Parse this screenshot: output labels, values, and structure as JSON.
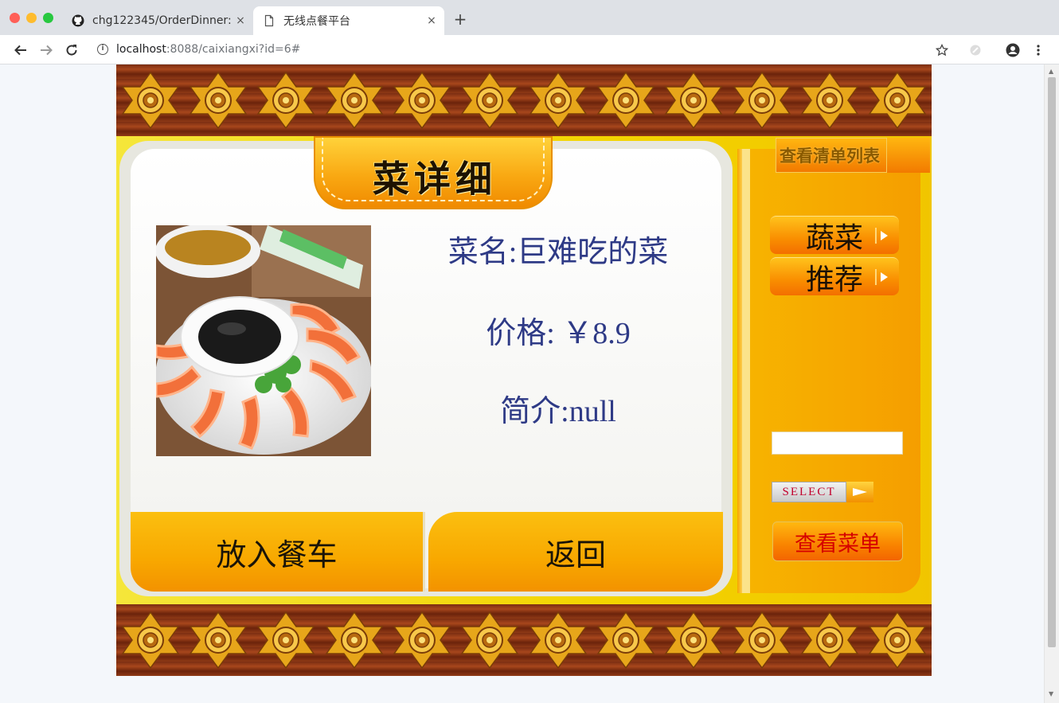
{
  "browser": {
    "tabs": [
      {
        "title": "chg122345/OrderDinner:",
        "icon": "github-icon",
        "active": false
      },
      {
        "title": "无线点餐平台",
        "icon": "document-icon",
        "active": true
      }
    ],
    "close_glyph": "×",
    "new_tab_glyph": "+",
    "url_host": "localhost",
    "url_rest": ":8088/caixiangxi?id=6#"
  },
  "page": {
    "title": "菜详细",
    "dish": {
      "name_text": "菜名:巨难吃的菜",
      "price_text": "价格: ￥8.9",
      "intro_text": "简介:null"
    },
    "buttons": {
      "add_to_cart": "放入餐车",
      "back": "返回"
    },
    "sidebar": {
      "view_list_label": "查看清单列表",
      "categories": [
        {
          "label": "蔬菜"
        },
        {
          "label": "推荐"
        }
      ],
      "search_value": "",
      "select_label": "SELECT",
      "view_menu_label": "查看菜单"
    }
  },
  "colors": {
    "accent_orange": "#f7a500",
    "text_blue": "#2e3a86",
    "menu_red": "#d60000",
    "border_brown": "#7a2d12"
  }
}
